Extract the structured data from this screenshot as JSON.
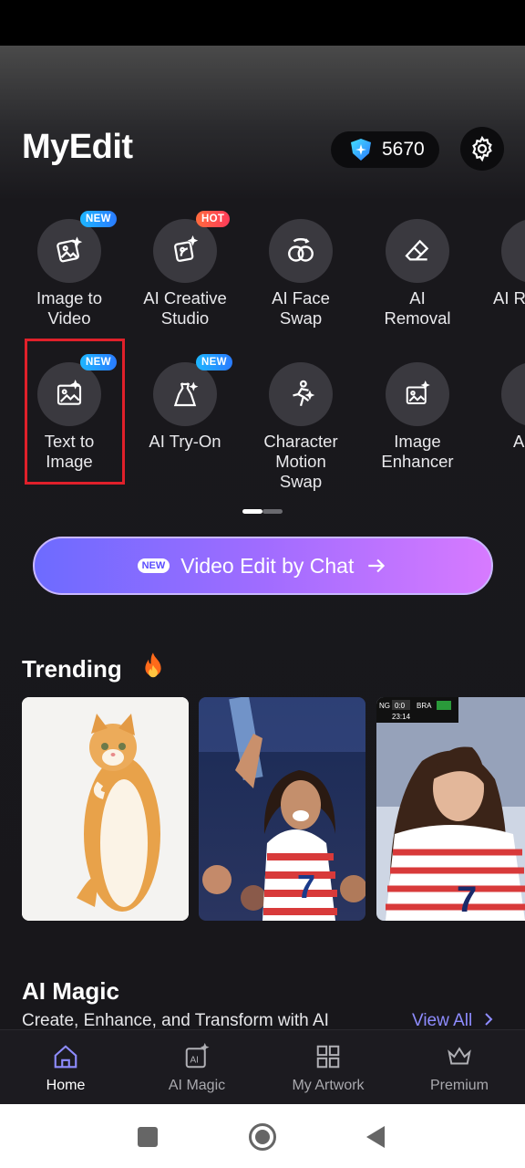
{
  "header": {
    "app_title": "MyEdit",
    "credits": "5670"
  },
  "tools_row1": [
    {
      "label": "Image to\nVideo",
      "badge": "NEW"
    },
    {
      "label": "AI Creative\nStudio",
      "badge": "HOT"
    },
    {
      "label": "AI Face\nSwap",
      "badge": ""
    },
    {
      "label": "AI\nRemoval",
      "badge": ""
    },
    {
      "label": "AI R",
      "badge": ""
    }
  ],
  "tools_row2": [
    {
      "label": "Text to\nImage",
      "badge": "NEW"
    },
    {
      "label": "AI Try-On",
      "badge": "NEW"
    },
    {
      "label": "Character\nMotion\nSwap",
      "badge": ""
    },
    {
      "label": "Image\nEnhancer",
      "badge": ""
    },
    {
      "label": "A",
      "badge": ""
    }
  ],
  "chat_button": {
    "badge": "NEW",
    "label": "Video Edit by Chat"
  },
  "trending": {
    "title": "Trending"
  },
  "ai_magic": {
    "title": "AI Magic",
    "subtitle": "Create, Enhance, and Transform with AI",
    "view_all": "View All"
  },
  "scoreboard": {
    "left": "NG",
    "score": "0:0",
    "right": "BRA",
    "time": "23:14"
  },
  "tabs": [
    {
      "label": "Home",
      "icon": "home-icon"
    },
    {
      "label": "AI Magic",
      "icon": "ai-magic-icon"
    },
    {
      "label": "My Artwork",
      "icon": "grid-icon"
    },
    {
      "label": "Premium",
      "icon": "crown-icon"
    }
  ],
  "colors": {
    "accent": "#8e8cff",
    "highlight": "#e0202a",
    "new_badge": "#2a7bff",
    "hot_badge": "#ff5a3d"
  }
}
